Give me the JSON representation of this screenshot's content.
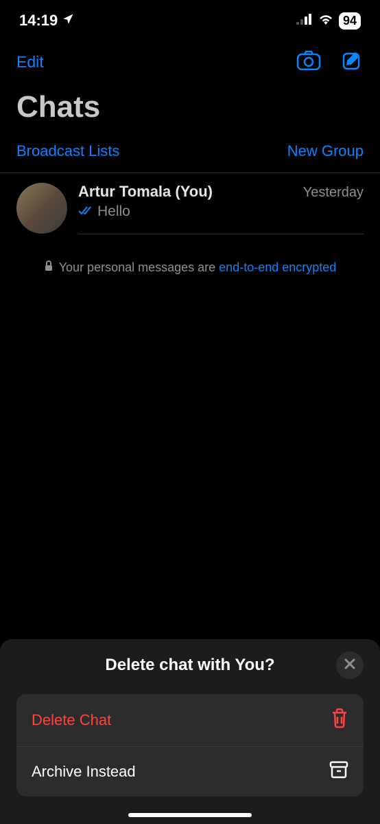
{
  "status": {
    "time": "14:19",
    "battery": "94"
  },
  "nav": {
    "edit": "Edit"
  },
  "title": "Chats",
  "subnav": {
    "broadcast": "Broadcast Lists",
    "newgroup": "New Group"
  },
  "chat": {
    "name": "Artur Tomala (You)",
    "time": "Yesterday",
    "preview": "Hello"
  },
  "encryption": {
    "prefix": "Your personal messages are ",
    "link": "end-to-end encrypted"
  },
  "sheet": {
    "title": "Delete chat with You?",
    "delete": "Delete Chat",
    "archive": "Archive Instead"
  }
}
